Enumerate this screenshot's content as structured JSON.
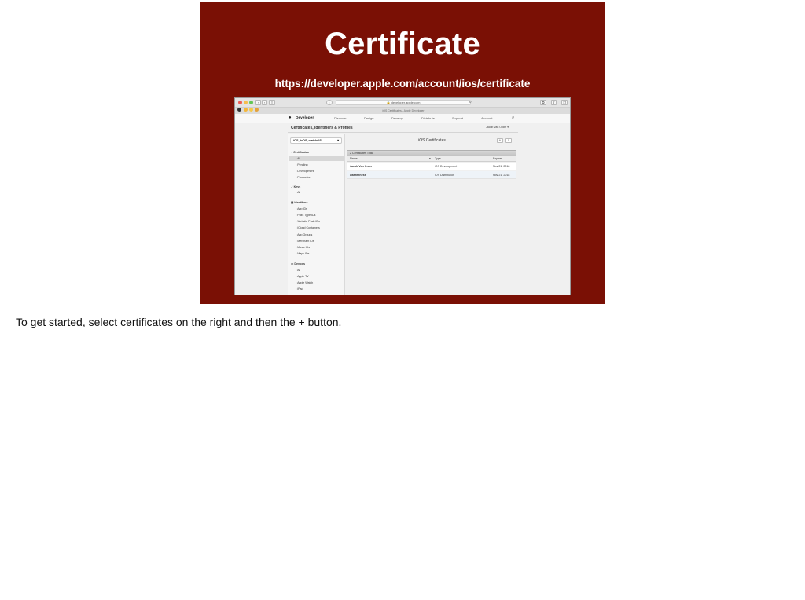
{
  "slide": {
    "title": "Certificate",
    "url": "https://developer.apple.com/account/ios/certificate"
  },
  "browser": {
    "address": "developer.apple.com",
    "tab_title": "iOS Certificates - Apple Developer",
    "nav": {
      "brand": "Developer",
      "items": [
        "Discover",
        "Design",
        "Develop",
        "Distribute",
        "Support",
        "Account"
      ]
    },
    "subheader": {
      "title": "Certificates, Identifiers & Profiles",
      "user": "Jacob Van Order"
    }
  },
  "sidebar": {
    "platform": "iOS, tvOS, watchOS",
    "sections": [
      {
        "title": "Certificates",
        "items": [
          "All",
          "Pending",
          "Development",
          "Production"
        ]
      },
      {
        "title": "Keys",
        "items": [
          "All"
        ]
      },
      {
        "title": "Identifiers",
        "items": [
          "App IDs",
          "Pass Type IDs",
          "Website Push IDs",
          "iCloud Containers",
          "App Groups",
          "Merchant IDs",
          "Music IDs",
          "Maps IDs"
        ]
      },
      {
        "title": "Devices",
        "items": [
          "All",
          "Apple TV",
          "Apple Watch",
          "iPad"
        ]
      }
    ]
  },
  "main": {
    "title": "iOS Certificates",
    "add_label": "+",
    "count_label": "2 Certificates Total",
    "columns": [
      "Name",
      "Type",
      "Expires"
    ],
    "rows": [
      {
        "name": "Jacob Van Order",
        "type": "iOS Development",
        "expires": "Nov 21, 2018"
      },
      {
        "name": "washfitness",
        "type": "iOS Distribution",
        "expires": "Nov 21, 2018"
      }
    ]
  },
  "caption": "To get started, select certificates on the right and then the + button."
}
